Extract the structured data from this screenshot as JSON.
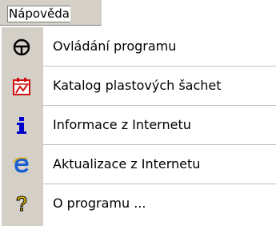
{
  "menu": {
    "title": "Nápověda"
  },
  "items": [
    {
      "label": "Ovládání programu",
      "icon": "steering-wheel-icon"
    },
    {
      "label": "Katalog plastových šachet",
      "icon": "catalog-icon"
    },
    {
      "label": "Informace z Internetu",
      "icon": "info-icon"
    },
    {
      "label": "Aktualizace z Internetu",
      "icon": "internet-explorer-icon"
    },
    {
      "label": "O programu ...",
      "icon": "help-icon"
    }
  ],
  "colors": {
    "gutter": "#d4d0c8",
    "info_blue": "#0000cc",
    "ie_blue": "#1a5fd1",
    "catalog_red": "#d01010",
    "help_yellow": "#e8c400"
  }
}
